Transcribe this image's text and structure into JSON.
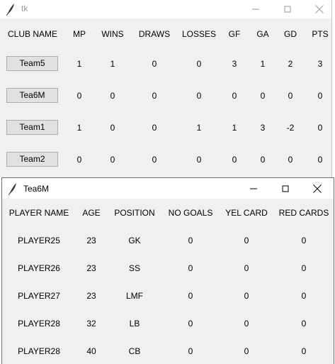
{
  "main_window": {
    "title": "tk",
    "headers": [
      "CLUB NAME",
      "MP",
      "WINS",
      "DRAWS",
      "LOSSES",
      "GF",
      "GA",
      "GD",
      "PTS"
    ],
    "rows": [
      {
        "team": "Team5",
        "mp": "1",
        "wins": "1",
        "draws": "0",
        "losses": "0",
        "gf": "3",
        "ga": "1",
        "gd": "2",
        "pts": "3"
      },
      {
        "team": "Tea6M",
        "mp": "0",
        "wins": "0",
        "draws": "0",
        "losses": "0",
        "gf": "0",
        "ga": "0",
        "gd": "0",
        "pts": "0"
      },
      {
        "team": "Team1",
        "mp": "1",
        "wins": "0",
        "draws": "0",
        "losses": "1",
        "gf": "1",
        "ga": "3",
        "gd": "-2",
        "pts": "0"
      },
      {
        "team": "Team2",
        "mp": "0",
        "wins": "0",
        "draws": "0",
        "losses": "0",
        "gf": "0",
        "ga": "0",
        "gd": "0",
        "pts": "0"
      }
    ]
  },
  "team_window": {
    "title": "Tea6M",
    "headers": [
      "PLAYER NAME",
      "AGE",
      "POSITION",
      "NO GOALS",
      "YEL CARD",
      "RED CARDS"
    ],
    "rows": [
      {
        "name": "PLAYER25",
        "age": "23",
        "position": "GK",
        "goals": "0",
        "yel": "0",
        "red": "0"
      },
      {
        "name": "PLAYER26",
        "age": "23",
        "position": "SS",
        "goals": "0",
        "yel": "0",
        "red": "0"
      },
      {
        "name": "PLAYER27",
        "age": "23",
        "position": "LMF",
        "goals": "0",
        "yel": "0",
        "red": "0"
      },
      {
        "name": "PLAYER28",
        "age": "32",
        "position": "LB",
        "goals": "0",
        "yel": "0",
        "red": "0"
      },
      {
        "name": "PLAYER28",
        "age": "40",
        "position": "CB",
        "goals": "0",
        "yel": "0",
        "red": "0"
      }
    ]
  },
  "icons": {
    "app_icon": "feather-icon",
    "minimize": "minimize-icon",
    "maximize": "maximize-icon",
    "close": "close-icon"
  }
}
